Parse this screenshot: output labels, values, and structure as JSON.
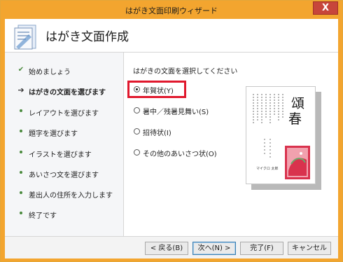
{
  "window": {
    "title": "はがき文面印刷ウィザード",
    "close_glyph": "X"
  },
  "header": {
    "title": "はがき文面作成",
    "logo_icon": "document-wizard-icon"
  },
  "steps": {
    "items": [
      {
        "label": "始めましょう",
        "state": "done"
      },
      {
        "label": "はがきの文面を選びます",
        "state": "current"
      },
      {
        "label": "レイアウトを選びます",
        "state": "pending"
      },
      {
        "label": "題字を選びます",
        "state": "pending"
      },
      {
        "label": "イラストを選びます",
        "state": "pending"
      },
      {
        "label": "あいさつ文を選びます",
        "state": "pending"
      },
      {
        "label": "差出人の住所を入力します",
        "state": "pending"
      },
      {
        "label": "終了です",
        "state": "pending"
      }
    ]
  },
  "content": {
    "instruction": "はがきの文面を選択してください",
    "options": [
      {
        "label": "年賀状(Y)",
        "selected": true
      },
      {
        "label": "暑中／残暑見舞い(S)",
        "selected": false
      },
      {
        "label": "招待状(I)",
        "selected": false
      },
      {
        "label": "その他のあいさつ状(O)",
        "selected": false
      }
    ],
    "preview": {
      "heading": "頌春",
      "signature": "マイクロ 太郎"
    }
  },
  "footer": {
    "back": "< 戻る(B)",
    "next": "次へ(N) >",
    "finish": "完了(F)",
    "cancel": "キャンセル"
  },
  "colors": {
    "titlebar": "#f3a52f",
    "highlight": "#e0182d",
    "illustration_red": "#d9324d",
    "illustration_green": "#6aa86a"
  }
}
